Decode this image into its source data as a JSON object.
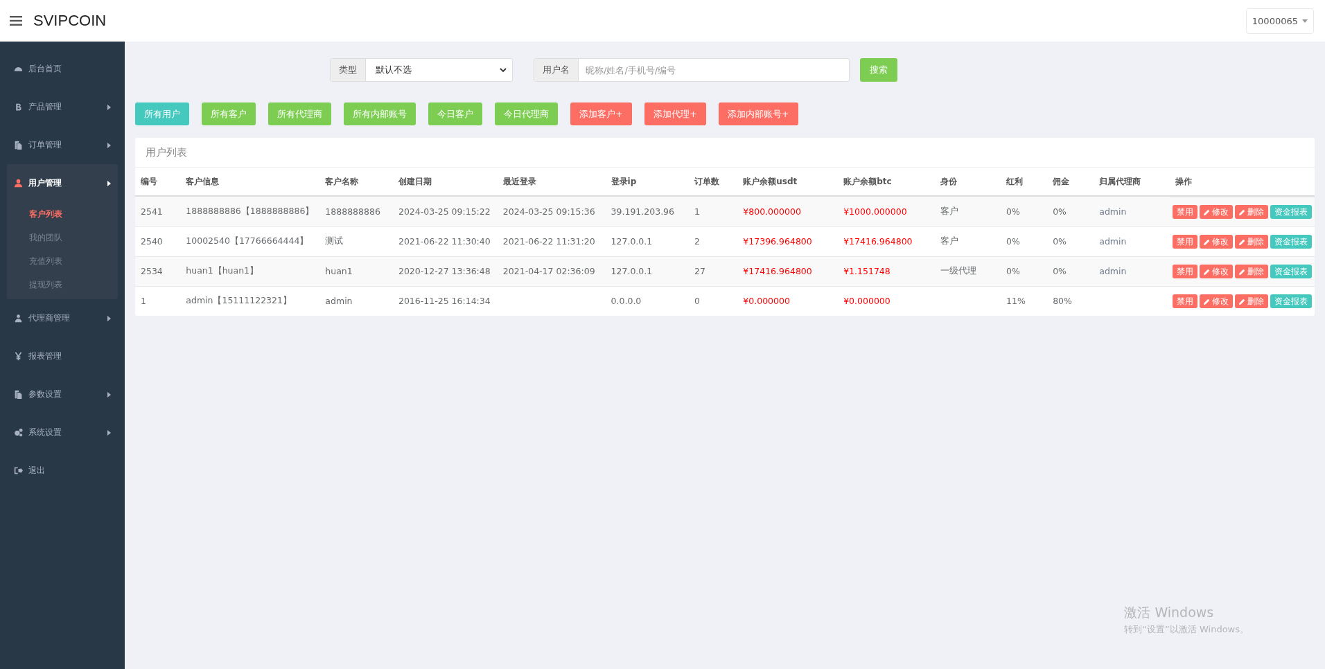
{
  "header": {
    "brand": "SVIPCOIN",
    "account": "10000065"
  },
  "sidebar": {
    "items": [
      {
        "kind": "dashboard",
        "label": "后台首页",
        "arrow": false,
        "selected": false
      },
      {
        "kind": "bitcoin",
        "label": "产品管理",
        "arrow": true,
        "selected": false
      },
      {
        "kind": "copy",
        "label": "订单管理",
        "arrow": true,
        "selected": false
      },
      {
        "kind": "user",
        "label": "用户管理",
        "arrow": true,
        "selected": true,
        "children": [
          {
            "label": "客户列表",
            "selected": true
          },
          {
            "label": "我的团队",
            "selected": false
          },
          {
            "label": "充值列表",
            "selected": false
          },
          {
            "label": "提现列表",
            "selected": false
          }
        ]
      },
      {
        "kind": "agent",
        "label": "代理商管理",
        "arrow": true,
        "selected": false
      },
      {
        "kind": "yen",
        "label": "报表管理",
        "arrow": false,
        "selected": false
      },
      {
        "kind": "copy",
        "label": "参数设置",
        "arrow": true,
        "selected": false
      },
      {
        "kind": "gears",
        "label": "系统设置",
        "arrow": true,
        "selected": false
      },
      {
        "kind": "logout",
        "label": "退出",
        "arrow": false,
        "selected": false
      }
    ]
  },
  "filters": {
    "type_label": "类型",
    "type_value": "默认不选",
    "name_label": "用户名",
    "name_placeholder": "昵称/姓名/手机号/编号",
    "search_button": "搜索"
  },
  "toolbar": [
    {
      "label": "所有用户",
      "color": "#45c8bd"
    },
    {
      "label": "所有客户",
      "color": "#7ccd52"
    },
    {
      "label": "所有代理商",
      "color": "#7ccd52"
    },
    {
      "label": "所有内部账号",
      "color": "#7ccd52"
    },
    {
      "label": "今日客户",
      "color": "#7ccd52"
    },
    {
      "label": "今日代理商",
      "color": "#7ccd52"
    },
    {
      "label": "添加客户+",
      "color": "#fc6d63"
    },
    {
      "label": "添加代理+",
      "color": "#fc6d63"
    },
    {
      "label": "添加内部账号+",
      "color": "#fc6d63"
    }
  ],
  "table": {
    "title": "用户列表",
    "columns": [
      "编号",
      "客户信息",
      "客户名称",
      "创建日期",
      "最近登录",
      "登录ip",
      "订单数",
      "账户余额usdt",
      "账户余额btc",
      "身份",
      "红利",
      "佣金",
      "归属代理商",
      "操作"
    ],
    "rows": [
      {
        "cells": [
          "2541",
          "1888888886【1888888886】",
          "1888888886",
          "2024-03-25 09:15:22",
          "2024-03-25 09:15:36",
          "39.191.203.96",
          "1",
          "¥800.000000",
          "¥1000.000000",
          "客户",
          "0%",
          "0%",
          "admin"
        ],
        "actions": [
          {
            "label": "禁用",
            "kind": "ban"
          },
          {
            "label": "修改",
            "kind": "edit"
          },
          {
            "label": "删除",
            "kind": "delete"
          },
          {
            "label": "资金报表",
            "kind": "report"
          }
        ]
      },
      {
        "cells": [
          "2540",
          "10002540【17766664444】",
          "测试",
          "2021-06-22 11:30:40",
          "2021-06-22 11:31:20",
          "127.0.0.1",
          "2",
          "¥17396.964800",
          "¥17416.964800",
          "客户",
          "0%",
          "0%",
          "admin"
        ],
        "actions": [
          {
            "label": "禁用",
            "kind": "ban"
          },
          {
            "label": "修改",
            "kind": "edit"
          },
          {
            "label": "删除",
            "kind": "delete"
          },
          {
            "label": "资金报表",
            "kind": "report"
          }
        ]
      },
      {
        "cells": [
          "2534",
          "huan1【huan1】",
          "huan1",
          "2020-12-27 13:36:48",
          "2021-04-17 02:36:09",
          "127.0.0.1",
          "27",
          "¥17416.964800",
          "¥1.151748",
          "一级代理",
          "0%",
          "0%",
          "admin"
        ],
        "actions": [
          {
            "label": "禁用",
            "kind": "ban"
          },
          {
            "label": "修改",
            "kind": "edit"
          },
          {
            "label": "删除",
            "kind": "delete"
          },
          {
            "label": "资金报表",
            "kind": "report"
          }
        ]
      },
      {
        "cells": [
          "1",
          "admin【15111122321】",
          "admin",
          "2016-11-25 16:14:34",
          "",
          "0.0.0.0",
          "0",
          "¥0.000000",
          "¥0.000000",
          "",
          "11%",
          "80%",
          ""
        ],
        "actions": [
          {
            "label": "禁用",
            "kind": "ban"
          },
          {
            "label": "修改",
            "kind": "edit"
          },
          {
            "label": "删除",
            "kind": "delete"
          },
          {
            "label": "资金报表",
            "kind": "report"
          }
        ]
      }
    ]
  },
  "activation": {
    "title": "激活 Windows",
    "hint": "转到“设置”以激活 Windows。"
  }
}
